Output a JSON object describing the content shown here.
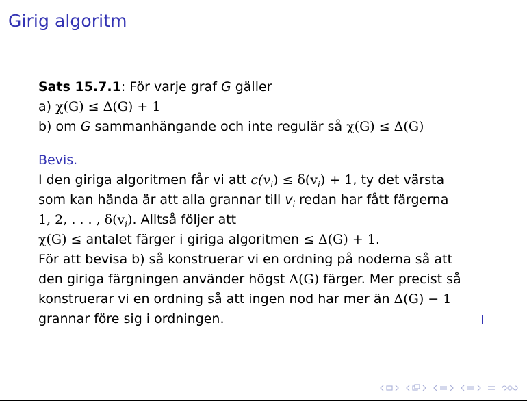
{
  "frame": {
    "title": "Girig algoritm"
  },
  "theorem": {
    "label": "Sats 15.7.1",
    "intro": ": För varje graf ",
    "graph_var": "G",
    "intro_end": " gäller",
    "part_a_prefix": "a) ",
    "part_a_math": "χ(G) ≤ Δ(G) + 1",
    "part_b_prefix": "b) om ",
    "part_b_var": "G",
    "part_b_text": " sammanhängande och inte regulär så ",
    "part_b_math": "χ(G) ≤ Δ(G)"
  },
  "proof": {
    "heading": "Bevis.",
    "lines": [
      [
        "I den giriga algoritmen får vi att ",
        "c(v",
        "i",
        ") ≤ δ(v",
        "i",
        ") + 1",
        ", ty det värsta"
      ],
      [
        "som kan hända är att alla grannar till ",
        "v",
        "i",
        " redan har fått färgerna"
      ],
      [
        "1, 2, . . . , δ(v",
        "i",
        ")",
        ". Alltså följer att"
      ],
      [
        "χ(G) ≤ ",
        " antalet färger i giriga algoritmen ",
        "≤ Δ(G) + 1",
        "."
      ],
      [
        "För att bevisa b) så konstruerar vi en ordning på noderna så att"
      ],
      [
        "den giriga färgningen använder högst ",
        "Δ(G)",
        " färger. Mer precist så"
      ],
      [
        "konstruerar vi en ordning så att ingen nod har mer än ",
        "Δ(G) − 1"
      ],
      [
        "grannar före sig i ordningen."
      ]
    ],
    "qed_symbol": "□"
  },
  "navigation": {
    "icons": [
      "frame-prev-icon",
      "frame-next-icon",
      "subsection-prev-icon",
      "subsection-next-icon",
      "section-prev-icon",
      "section-next-icon",
      "align-icon",
      "search-icon"
    ]
  },
  "colors": {
    "title": "#3333b3",
    "proof_heading": "#3333b3",
    "nav": "#aab0d8",
    "text": "#000000"
  }
}
